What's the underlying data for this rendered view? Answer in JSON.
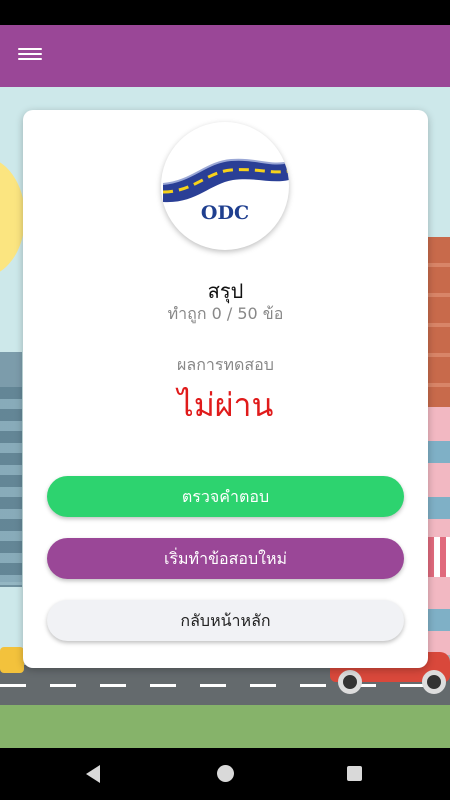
{
  "app_bar": {
    "menu_icon": "hamburger-menu-icon",
    "color": "#9a4797"
  },
  "logo": {
    "text": "ODC"
  },
  "summary": {
    "title": "สรุป",
    "score": "ทำถูก 0 / 50 ข้อ",
    "result_label": "ผลการทดสอบ",
    "result_value": "ไม่ผ่าน",
    "result_color": "#e01b1b"
  },
  "buttons": {
    "check_answers": "ตรวจคำตอบ",
    "restart": "เริ่มทำข้อสอบใหม่",
    "home": "กลับหน้าหลัก"
  },
  "colors": {
    "primary": "#9a4797",
    "success": "#2dd36f",
    "light": "#f1f2f5"
  },
  "nav": {
    "back_icon": "back-triangle-icon",
    "home_icon": "home-circle-icon",
    "recent_icon": "recent-apps-square-icon"
  }
}
